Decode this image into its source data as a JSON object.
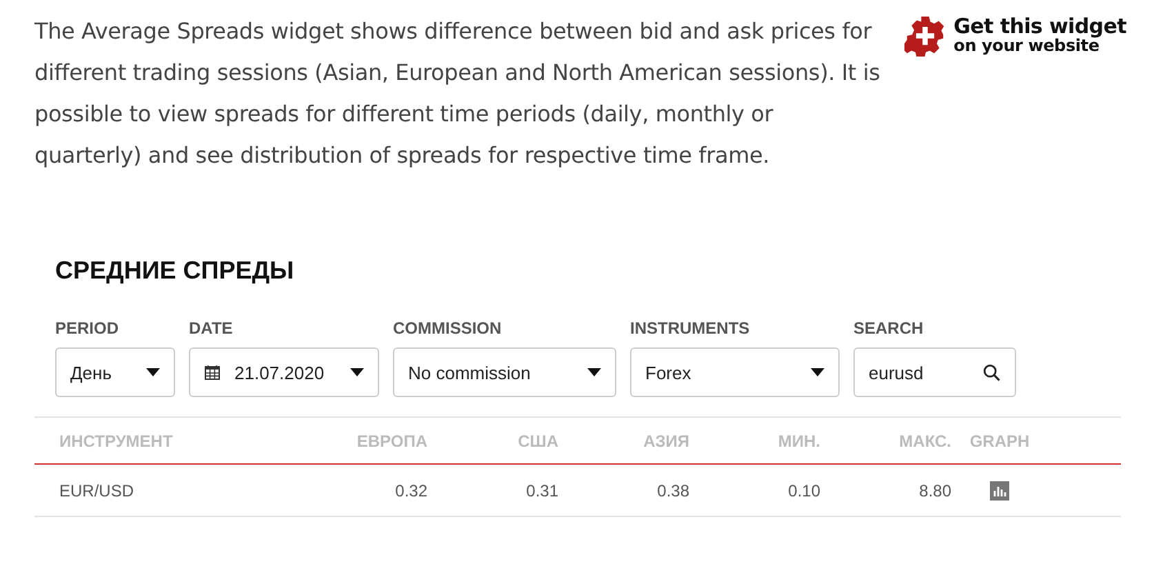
{
  "intro": "The Average Spreads widget shows difference between bid and ask prices for different trading sessions (Asian, European and North American sessions). It is possible to view spreads for different time periods (daily, monthly or quarterly) and see distribution of spreads for respective time frame.",
  "widget_link": {
    "line_1": "Get this widget",
    "line_2": "on your website"
  },
  "title": "СРЕДНИЕ СПРЕДЫ",
  "filters": [
    {
      "kind": "select",
      "label": "PERIOD",
      "value": "День"
    },
    {
      "kind": "date",
      "label": "DATE",
      "value": "21.07.2020"
    },
    {
      "kind": "select",
      "label": "COMMISSION",
      "value": "No commission"
    },
    {
      "kind": "select",
      "label": "INSTRUMENTS",
      "value": "Forex"
    },
    {
      "kind": "search",
      "label": "SEARCH",
      "value": "eurusd"
    }
  ],
  "table": {
    "columns": [
      "ИНСТРУМЕНТ",
      "ЕВРОПА",
      "США",
      "АЗИЯ",
      "МИН.",
      "МАКС.",
      "GRAPH"
    ],
    "rows": [
      {
        "cells": [
          "EUR/USD",
          "0.32",
          "0.31",
          "0.38",
          "0.10",
          "8.80"
        ]
      }
    ]
  }
}
